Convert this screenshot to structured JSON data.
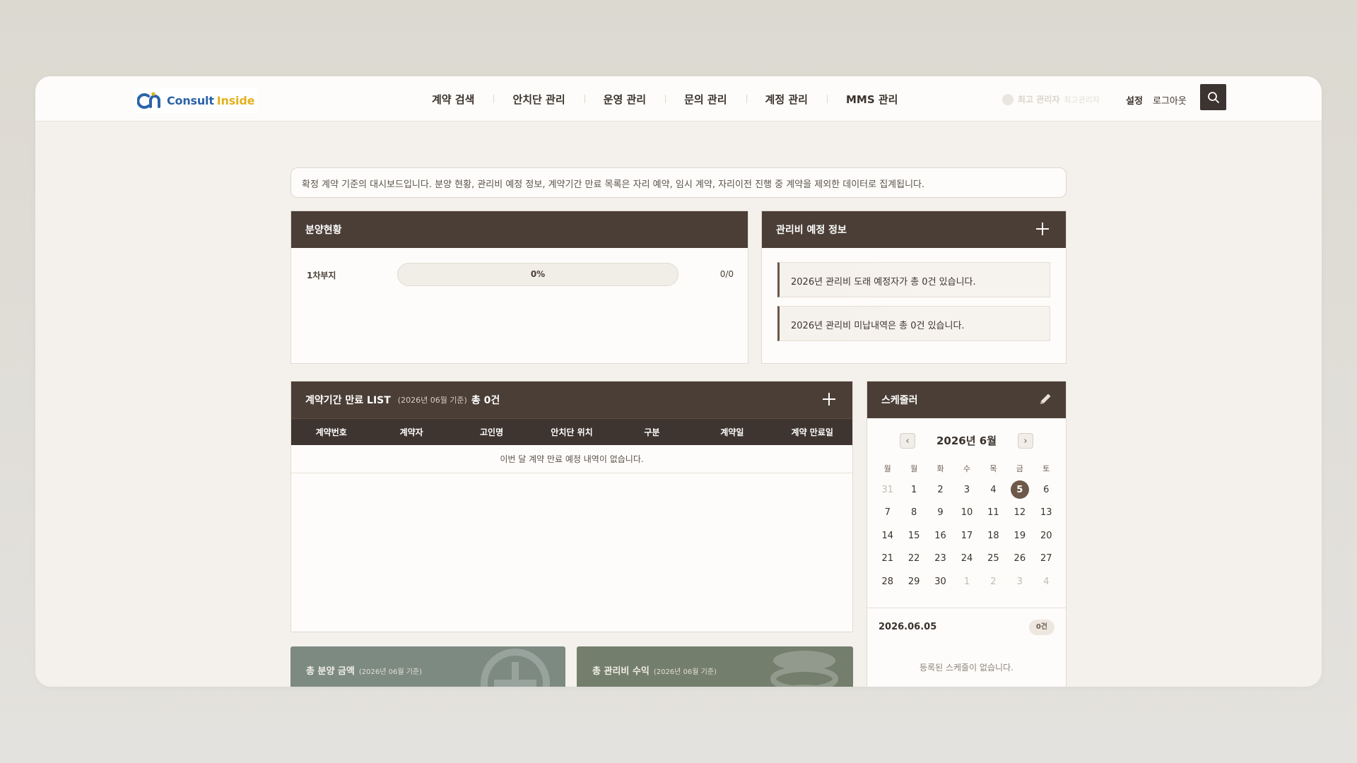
{
  "brand": {
    "part1": "Consult",
    "part2": "Inside"
  },
  "nav": [
    "계약 검색",
    "안치단 관리",
    "운영 관리",
    "문의 관리",
    "계정 관리",
    "MMS 관리"
  ],
  "user": {
    "role": "최고 관리자",
    "sub": "최고관리자"
  },
  "header": {
    "settings": "설정",
    "logout": "로그아웃"
  },
  "notice": "확정 계약 기준의 대시보드입니다. 분양 현황, 관리비 예정 정보, 계약기간 만료 목록은 자리 예약, 임시 계약, 자리이전 진행 중 계약을 제외한 데이터로 집계됩니다.",
  "sales": {
    "title": "분양현황",
    "rows": [
      {
        "label": "1차부지",
        "percent_text": "0%",
        "percent": 0,
        "count": "0/0"
      }
    ]
  },
  "fee": {
    "title": "관리비 예정 정보",
    "items": [
      "2026년 관리비 도래 예정자가 총 0건 있습니다.",
      "2026년 관리비 미납내역은 총 0건 있습니다."
    ]
  },
  "expire": {
    "title": "계약기간 만료 LIST",
    "subtitle": "(2026년 06월 기준)",
    "total": "총 0건",
    "columns": [
      "계약번호",
      "계약자",
      "고인명",
      "안치단 위치",
      "구분",
      "계약일",
      "계약 만료일"
    ],
    "empty": "이번 달 계약 만료 예정 내역이 없습니다."
  },
  "schedule": {
    "title": "스케줄러",
    "month": "2026년 6월",
    "prev": "‹",
    "next": "›",
    "weekdays": [
      "월",
      "월",
      "화",
      "수",
      "목",
      "금",
      "토"
    ],
    "weeks": [
      [
        "31",
        "1",
        "2",
        "3",
        "4",
        "5",
        "6"
      ],
      [
        "7",
        "8",
        "9",
        "10",
        "11",
        "12",
        "13"
      ],
      [
        "14",
        "15",
        "16",
        "17",
        "18",
        "19",
        "20"
      ],
      [
        "21",
        "22",
        "23",
        "24",
        "25",
        "26",
        "27"
      ],
      [
        "28",
        "29",
        "30",
        "1",
        "2",
        "3",
        "4"
      ]
    ],
    "selected_date": "2026.06.05",
    "count": "0건",
    "empty": "등록된 스케줄이 없습니다."
  },
  "cards": [
    {
      "title": "총 분양 금액",
      "sub": "(2026년 06월 기준)"
    },
    {
      "title": "총 관리비 수익",
      "sub": "(2026년 06월 기준)"
    }
  ],
  "colors": {
    "header_bg": "#4a3e36",
    "accent": "#6d5949",
    "bg": "#f4f1ec",
    "card1": "#7c8a82",
    "card2": "#737e6c"
  }
}
